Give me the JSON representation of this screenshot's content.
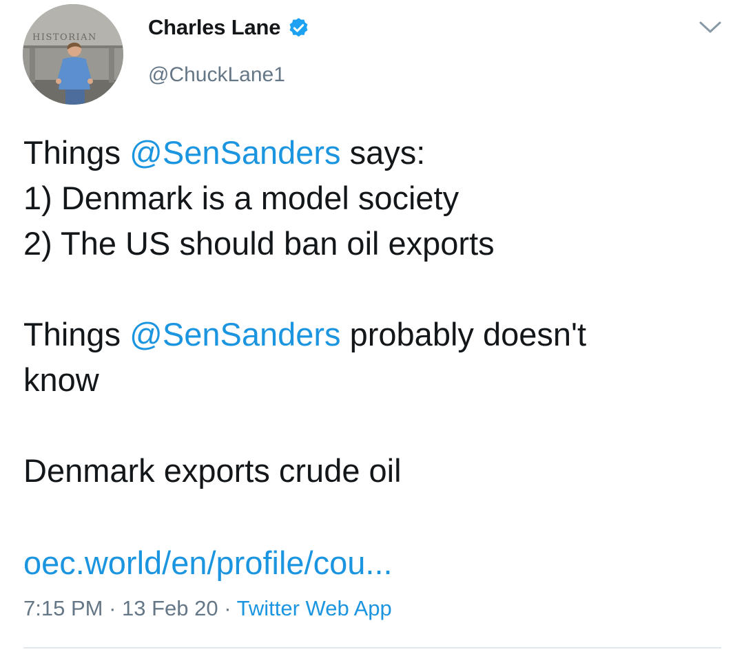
{
  "author": {
    "display_name": "Charles Lane",
    "handle": "@ChuckLane1",
    "verified": true,
    "avatar_sign_text": "HISTORIAN"
  },
  "tweet": {
    "line1": {
      "prefix": "Things ",
      "mention": "@SenSanders",
      "suffix": " says:"
    },
    "line2": "1) Denmark is a model society",
    "line3": "2) The US should ban oil exports",
    "line4": {
      "prefix": "Things ",
      "mention": "@SenSanders",
      "suffix": " probably doesn't"
    },
    "line5": "know",
    "line6": "Denmark exports crude oil",
    "link_text": "oec.world/en/profile/cou..."
  },
  "meta": {
    "time": "7:15 PM",
    "separator": " · ",
    "date": "13 Feb 20",
    "source": "Twitter Web App"
  },
  "colors": {
    "link": "#1b95e0",
    "muted": "#657786",
    "text": "#14171a",
    "verified_badge": "#1da1f2"
  },
  "icons": {
    "verified": "verified-badge-icon",
    "menu": "chevron-down-icon"
  }
}
